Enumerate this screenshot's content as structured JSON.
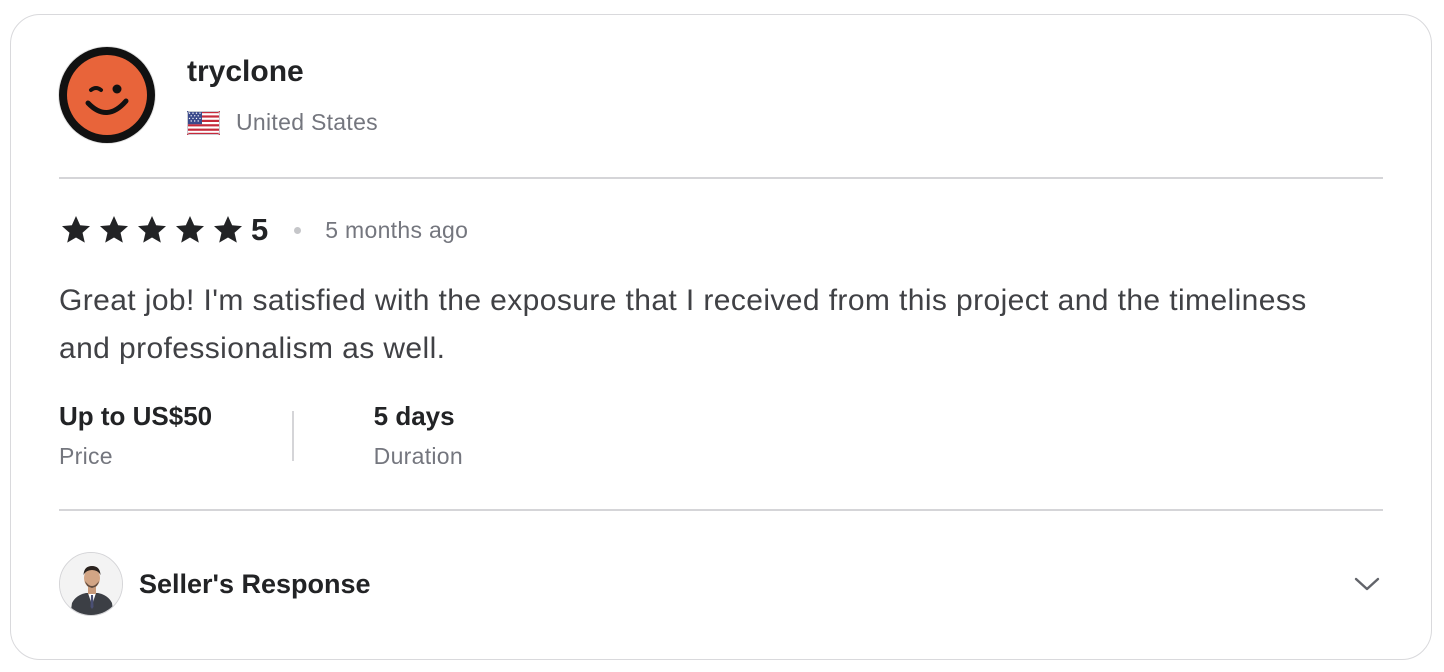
{
  "reviewer": {
    "username": "tryclone",
    "country": "United States",
    "avatar_icon": "winking-face-icon",
    "flag_icon": "us-flag-icon"
  },
  "review": {
    "rating_value": "5",
    "stars_filled": 5,
    "stars_total": 5,
    "time_ago": "5 months ago",
    "text": "Great job! I'm satisfied with the exposure that I received from this project and the timeliness and professionalism as well."
  },
  "meta": {
    "price_value": "Up to US$50",
    "price_label": "Price",
    "duration_value": "5 days",
    "duration_label": "Duration"
  },
  "seller_response": {
    "title": "Seller's Response",
    "expand_icon": "chevron-down-icon"
  },
  "colors": {
    "avatar_face": "#e8643a",
    "avatar_bg": "#111111",
    "star": "#222325",
    "muted_text": "#74767e",
    "border": "#d9d9dc"
  }
}
